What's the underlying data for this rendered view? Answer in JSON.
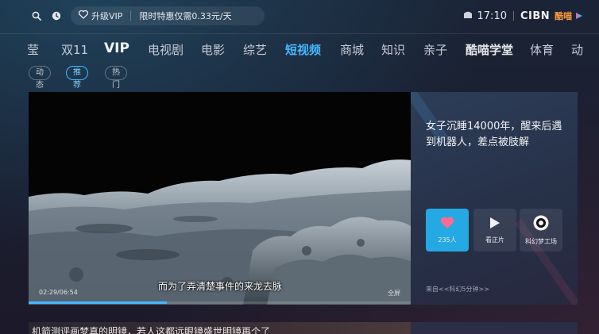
{
  "status_bar": {
    "vip_label": "升级VIP",
    "promo_text": "限时特惠仅需0.33元/天",
    "time": "17:10",
    "brand": "CIBN",
    "brand_app": "酷喵"
  },
  "nav": {
    "items": [
      {
        "label": "莹",
        "style": "clip-left"
      },
      {
        "label": "双11",
        "style": "normal"
      },
      {
        "label": "VIP",
        "style": "vip"
      },
      {
        "label": "电视剧",
        "style": "normal"
      },
      {
        "label": "电影",
        "style": "normal"
      },
      {
        "label": "综艺",
        "style": "normal"
      },
      {
        "label": "短视频",
        "style": "active"
      },
      {
        "label": "商城",
        "style": "normal"
      },
      {
        "label": "知识",
        "style": "normal"
      },
      {
        "label": "亲子",
        "style": "normal"
      },
      {
        "label": "酷喵学堂",
        "style": "bold"
      },
      {
        "label": "体育",
        "style": "normal"
      },
      {
        "label": "动",
        "style": "clip-right"
      }
    ]
  },
  "sub_tabs": [
    {
      "label": "动态",
      "selected": false
    },
    {
      "label": "推荐",
      "selected": true
    },
    {
      "label": "热门",
      "selected": false
    }
  ],
  "player": {
    "subtitle": "而为了弄清楚事件的来龙去脉",
    "time": "02:29/06:54",
    "fullscreen_label": "全屏",
    "progress": 0.36
  },
  "detail": {
    "title": "女子沉睡14000年，醒来后遇到机器人，差点被肢解",
    "actions": [
      {
        "label": "235人",
        "icon": "heart-icon",
        "highlight": true
      },
      {
        "label": "看正片",
        "icon": "play-icon",
        "highlight": false
      },
      {
        "label": "科幻梦工场",
        "icon": "channel-avatar-icon",
        "highlight": false
      }
    ],
    "source": "来自<<科幻5分钟>>"
  },
  "next_card": {
    "title": "机箭测评画梦真的明镜，若人这都远眼镜盛世明镜再个了"
  },
  "colors": {
    "accent": "#45b8ff",
    "like_button": "#25a9e3"
  }
}
